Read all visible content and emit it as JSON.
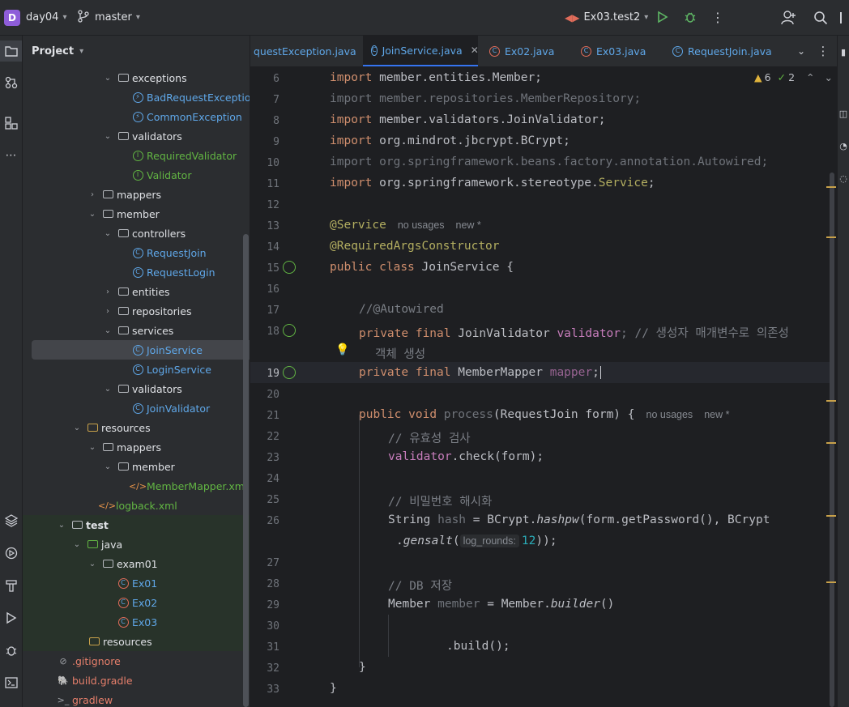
{
  "topbar": {
    "project_initial": "D",
    "project_name": "day04",
    "branch": "master",
    "run_config": "Ex03.test2"
  },
  "project_panel": {
    "title": "Project",
    "tree": [
      {
        "label": "exceptions",
        "kind": "folder",
        "expanded": true
      },
      {
        "label": "BadRequestException",
        "kind": "exception"
      },
      {
        "label": "CommonException",
        "kind": "exception"
      },
      {
        "label": "validators",
        "kind": "folder",
        "expanded": true
      },
      {
        "label": "RequiredValidator",
        "kind": "interface"
      },
      {
        "label": "Validator",
        "kind": "interface"
      },
      {
        "label": "mappers",
        "kind": "folder",
        "expanded": false
      },
      {
        "label": "member",
        "kind": "folder",
        "expanded": true
      },
      {
        "label": "controllers",
        "kind": "folder",
        "expanded": true
      },
      {
        "label": "RequestJoin",
        "kind": "class"
      },
      {
        "label": "RequestLogin",
        "kind": "class"
      },
      {
        "label": "entities",
        "kind": "folder",
        "expanded": false
      },
      {
        "label": "repositories",
        "kind": "folder",
        "expanded": false
      },
      {
        "label": "services",
        "kind": "folder",
        "expanded": true
      },
      {
        "label": "JoinService",
        "kind": "class",
        "selected": true
      },
      {
        "label": "LoginService",
        "kind": "class"
      },
      {
        "label": "validators",
        "kind": "folder",
        "expanded": true
      },
      {
        "label": "JoinValidator",
        "kind": "class"
      },
      {
        "label": "resources",
        "kind": "folder",
        "expanded": true
      },
      {
        "label": "mappers",
        "kind": "folder",
        "expanded": true
      },
      {
        "label": "member",
        "kind": "folder",
        "expanded": true
      },
      {
        "label": "MemberMapper.xml",
        "kind": "xml"
      },
      {
        "label": "logback.xml",
        "kind": "xml"
      },
      {
        "label": "test",
        "kind": "folder",
        "expanded": true
      },
      {
        "label": "java",
        "kind": "folder",
        "expanded": true
      },
      {
        "label": "exam01",
        "kind": "folder",
        "expanded": true
      },
      {
        "label": "Ex01",
        "kind": "testclass"
      },
      {
        "label": "Ex02",
        "kind": "testclass"
      },
      {
        "label": "Ex03",
        "kind": "testclass"
      },
      {
        "label": "resources",
        "kind": "folder"
      },
      {
        "label": ".gitignore",
        "kind": "ignore"
      },
      {
        "label": "build.gradle",
        "kind": "gradle"
      },
      {
        "label": "gradlew",
        "kind": "script"
      }
    ]
  },
  "tabs": [
    {
      "label": "questException.java"
    },
    {
      "label": "JoinService.java",
      "active": true
    },
    {
      "label": "Ex02.java"
    },
    {
      "label": "Ex03.java"
    },
    {
      "label": "RequestJoin.java"
    }
  ],
  "inspections": {
    "warnings": "6",
    "weak_warnings": "2"
  },
  "hints": {
    "no_usages": "no usages",
    "new": "new *",
    "log_rounds": "log_rounds:"
  },
  "code": {
    "l6": [
      "import",
      " member.entities.Member;"
    ],
    "l7": "import member.repositories.MemberRepository;",
    "l8": [
      "import",
      " member.validators.JoinValidator;"
    ],
    "l9": [
      "import",
      " org.mindrot.jbcrypt.BCrypt;"
    ],
    "l10": "import org.springframework.beans.factory.annotation.Autowired;",
    "l11": [
      "import",
      " org.springframework.stereotype.",
      "Service",
      ";"
    ],
    "l13": "@Service",
    "l14": "@RequiredArgsConstructor",
    "l15": [
      "public",
      " ",
      "class",
      " JoinService {"
    ],
    "l17": "//@Autowired",
    "l18": [
      "private",
      " ",
      "final",
      " JoinValidator ",
      "validator",
      "; // 생성자 매개변수로 의존성"
    ],
    "l18b": "객체 생성",
    "l19": [
      "private",
      " ",
      "final",
      " MemberMapper ",
      "mapper",
      ";"
    ],
    "l21": [
      "public",
      " ",
      "void",
      " ",
      "process",
      "(RequestJoin form) {"
    ],
    "l22": "// 유효성 검사",
    "l23": [
      "validator",
      ".check(form);"
    ],
    "l25": "// 비밀번호 해시화",
    "l26": [
      "String ",
      "hash",
      " = BCrypt.",
      "hashpw",
      "(form.getPassword(), BCrypt"
    ],
    "l26b": [
      ".",
      "gensalt",
      "(",
      "12",
      "));"
    ],
    "l28": "// DB 저장",
    "l29": [
      "Member ",
      "member",
      " = Member.",
      "builder",
      "()"
    ],
    "l31": ".build();",
    "l32": "}",
    "l33": "}"
  },
  "line_numbers": [
    "6",
    "7",
    "8",
    "9",
    "10",
    "11",
    "12",
    "13",
    "14",
    "15",
    "16",
    "17",
    "18",
    "",
    "19",
    "20",
    "21",
    "22",
    "23",
    "24",
    "25",
    "26",
    "",
    "27",
    "28",
    "29",
    "30",
    "31",
    "32",
    "33"
  ]
}
